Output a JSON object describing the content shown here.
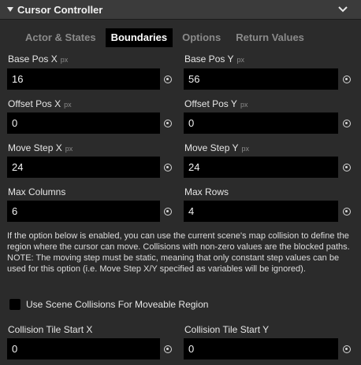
{
  "header": {
    "title": "Cursor Controller"
  },
  "tabs": [
    {
      "label": "Actor & States"
    },
    {
      "label": "Boundaries"
    },
    {
      "label": "Options"
    },
    {
      "label": "Return Values"
    }
  ],
  "active_tab": "Boundaries",
  "fields": {
    "base_pos_x": {
      "label": "Base Pos X",
      "unit": "px",
      "value": "16"
    },
    "base_pos_y": {
      "label": "Base Pos Y",
      "unit": "px",
      "value": "56"
    },
    "offset_pos_x": {
      "label": "Offset Pos X",
      "unit": "px",
      "value": "0"
    },
    "offset_pos_y": {
      "label": "Offset Pos Y",
      "unit": "px",
      "value": "0"
    },
    "move_step_x": {
      "label": "Move Step X",
      "unit": "px",
      "value": "24"
    },
    "move_step_y": {
      "label": "Move Step Y",
      "unit": "px",
      "value": "24"
    },
    "max_columns": {
      "label": "Max Columns",
      "value": "6"
    },
    "max_rows": {
      "label": "Max Rows",
      "value": "4"
    },
    "collision_tile_start_x": {
      "label": "Collision Tile Start X",
      "value": "0"
    },
    "collision_tile_start_y": {
      "label": "Collision Tile Start Y",
      "value": "0"
    }
  },
  "description": "If the option below is enabled, you can use the current scene's map collision to define the region where the cursor can move. Collisions with non-zero values are the blocked paths. NOTE: The moving step must be static, meaning that only constant step values can be used for this option (i.e. Move Step X/Y specified as variables will be ignored).",
  "scene_collisions": {
    "label": "Use Scene Collisions For Moveable Region",
    "checked": false
  }
}
